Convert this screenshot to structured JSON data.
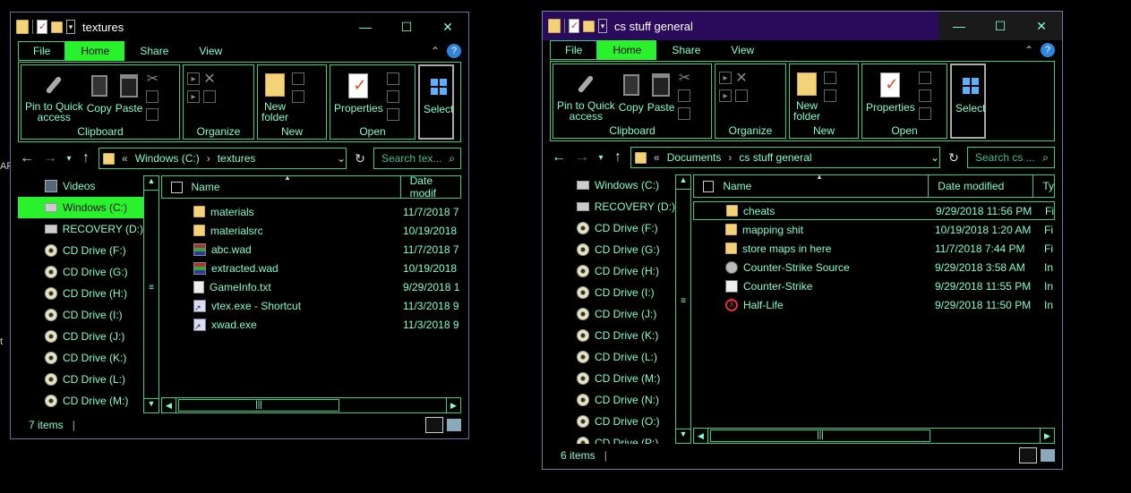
{
  "stray_text": [
    "AR",
    "t"
  ],
  "ribbon": {
    "tabs": [
      "File",
      "Home",
      "Share",
      "View"
    ],
    "clipboard": {
      "pin": "Pin to Quick\naccess",
      "copy": "Copy",
      "paste": "Paste",
      "label": "Clipboard"
    },
    "organize": {
      "label": "Organize"
    },
    "new": {
      "folder": "New\nfolder",
      "label": "New"
    },
    "open": {
      "properties": "Properties",
      "label": "Open"
    },
    "select": {
      "label": "Select"
    }
  },
  "windows": [
    {
      "title": "textures",
      "path": [
        "Windows (C:)",
        "textures"
      ],
      "search_placeholder": "Search tex...",
      "nav": [
        {
          "label": "Videos",
          "icon": "video-icon"
        },
        {
          "label": "Windows (C:)",
          "icon": "drive-icon",
          "active": true
        },
        {
          "label": "RECOVERY (D:)",
          "icon": "drive-icon"
        },
        {
          "label": "CD Drive (F:)",
          "icon": "cd-icon"
        },
        {
          "label": "CD Drive (G:)",
          "icon": "cd-icon"
        },
        {
          "label": "CD Drive (H:)",
          "icon": "cd-icon"
        },
        {
          "label": "CD Drive (I:)",
          "icon": "cd-icon"
        },
        {
          "label": "CD Drive (J:)",
          "icon": "cd-icon"
        },
        {
          "label": "CD Drive (K:)",
          "icon": "cd-icon"
        },
        {
          "label": "CD Drive (L:)",
          "icon": "cd-icon"
        },
        {
          "label": "CD Drive (M:)",
          "icon": "cd-icon"
        }
      ],
      "columns": [
        "Name",
        "Date modif"
      ],
      "files": [
        {
          "name": "materials",
          "date": "11/7/2018 7",
          "icon": "folder"
        },
        {
          "name": "materialsrc",
          "date": "10/19/2018",
          "icon": "folder"
        },
        {
          "name": "abc.wad",
          "date": "11/7/2018 7",
          "icon": "wad"
        },
        {
          "name": "extracted.wad",
          "date": "10/19/2018",
          "icon": "wad"
        },
        {
          "name": "GameInfo.txt",
          "date": "9/29/2018 1",
          "icon": "file"
        },
        {
          "name": "vtex.exe - Shortcut",
          "date": "11/3/2018 9",
          "icon": "shortcut"
        },
        {
          "name": "xwad.exe",
          "date": "11/3/2018 9",
          "icon": "shortcut"
        }
      ],
      "status": "7 items"
    },
    {
      "title": "cs stuff general",
      "path": [
        "Documents",
        "cs stuff general"
      ],
      "search_placeholder": "Search cs ...",
      "nav": [
        {
          "label": "Windows (C:)",
          "icon": "drive-icon"
        },
        {
          "label": "RECOVERY (D:)",
          "icon": "drive-icon"
        },
        {
          "label": "CD Drive (F:)",
          "icon": "cd-icon"
        },
        {
          "label": "CD Drive (G:)",
          "icon": "cd-icon"
        },
        {
          "label": "CD Drive (H:)",
          "icon": "cd-icon"
        },
        {
          "label": "CD Drive (I:)",
          "icon": "cd-icon"
        },
        {
          "label": "CD Drive (J:)",
          "icon": "cd-icon"
        },
        {
          "label": "CD Drive (K:)",
          "icon": "cd-icon"
        },
        {
          "label": "CD Drive (L:)",
          "icon": "cd-icon"
        },
        {
          "label": "CD Drive (M:)",
          "icon": "cd-icon"
        },
        {
          "label": "CD Drive (N:)",
          "icon": "cd-icon"
        },
        {
          "label": "CD Drive (O:)",
          "icon": "cd-icon"
        },
        {
          "label": "CD Drive (P:)",
          "icon": "cd-icon"
        }
      ],
      "columns": [
        "Name",
        "Date modified",
        "Ty"
      ],
      "files": [
        {
          "name": "cheats",
          "date": "9/29/2018 11:56 PM",
          "type": "Fi",
          "icon": "folder",
          "selected": true
        },
        {
          "name": "mapping shit",
          "date": "10/19/2018 1:20 AM",
          "type": "Fi",
          "icon": "folder"
        },
        {
          "name": "store maps in here",
          "date": "11/7/2018 7:44 PM",
          "type": "Fi",
          "icon": "folder"
        },
        {
          "name": "Counter-Strike Source",
          "date": "9/29/2018 3:58 AM",
          "type": "In",
          "icon": "css"
        },
        {
          "name": "Counter-Strike",
          "date": "9/29/2018 11:55 PM",
          "type": "In",
          "icon": "cs"
        },
        {
          "name": "Half-Life",
          "date": "9/29/2018 11:50 PM",
          "type": "In",
          "icon": "hl"
        }
      ],
      "status": "6 items"
    }
  ],
  "colors": {
    "accent": "#29f12c",
    "text": "#7fffd4",
    "border": "#33cc88",
    "title_bg_w2": "#2a0a5a"
  }
}
